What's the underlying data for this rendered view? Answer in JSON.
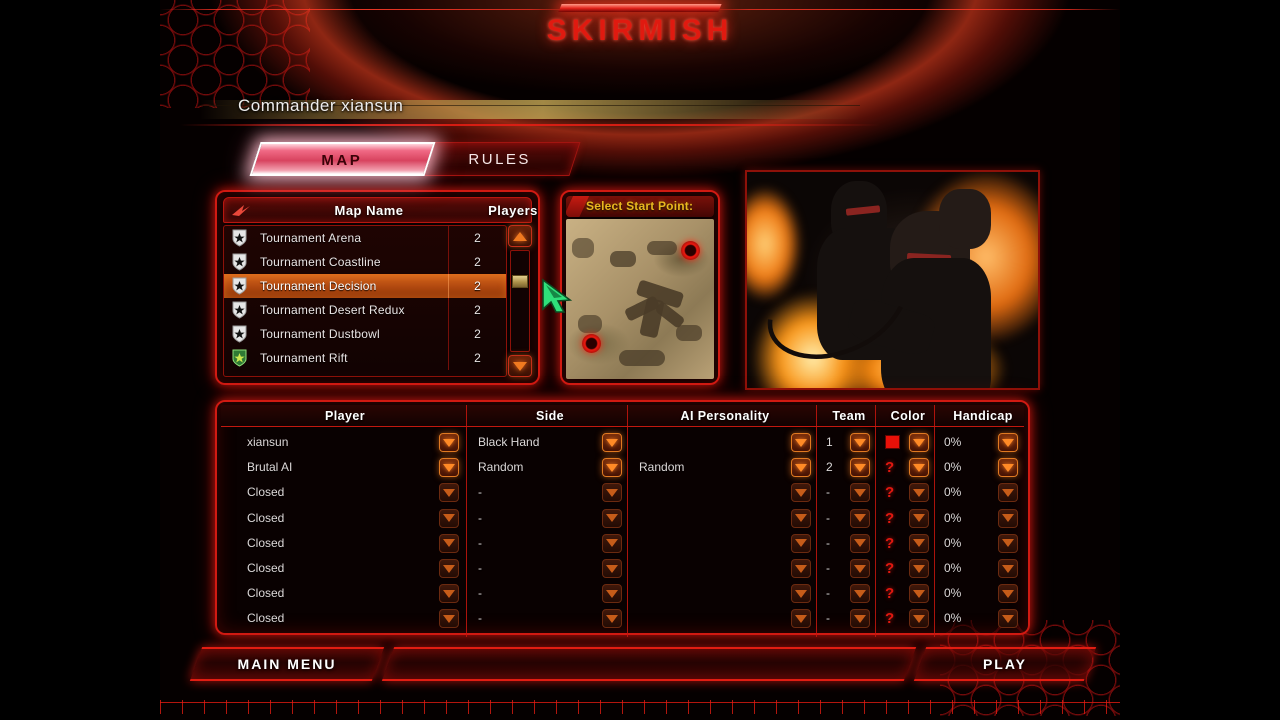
{
  "window": {
    "title": "SKIRMISH",
    "commander_label": "Commander xiansun"
  },
  "theme": {
    "accent_red": "#e21d12",
    "accent_orange": "#f07a20",
    "accent_gold": "#e9b81f",
    "selected_row": "#d96a1e",
    "player_color_swatch": "#e81008"
  },
  "tabs": [
    {
      "id": "map",
      "label": "MAP",
      "selected": true
    },
    {
      "id": "rules",
      "label": "RULES",
      "selected": false
    }
  ],
  "map_list": {
    "headers": {
      "name": "Map Name",
      "players": "Players"
    },
    "rows": [
      {
        "name": "Tournament Arena",
        "players": "2",
        "icon": "shield-star-icon",
        "official": true,
        "selected": false
      },
      {
        "name": "Tournament Coastline",
        "players": "2",
        "icon": "shield-star-icon",
        "official": true,
        "selected": false
      },
      {
        "name": "Tournament Decision",
        "players": "2",
        "icon": "shield-star-icon",
        "official": true,
        "selected": true
      },
      {
        "name": "Tournament Desert Redux",
        "players": "2",
        "icon": "shield-star-icon",
        "official": true,
        "selected": false
      },
      {
        "name": "Tournament Dustbowl",
        "players": "2",
        "icon": "shield-star-icon",
        "official": true,
        "selected": false
      },
      {
        "name": "Tournament Rift",
        "players": "2",
        "icon": "shield-star-green-icon",
        "official": false,
        "selected": false
      }
    ],
    "scrollbar": {
      "up": "scroll-up-icon",
      "down": "scroll-down-icon"
    }
  },
  "start_point": {
    "label": "Select Start Point:",
    "markers": [
      {
        "id": "start-point-1",
        "x": 78,
        "y": 18
      },
      {
        "id": "start-point-2",
        "x": 14,
        "y": 75
      }
    ]
  },
  "faction_art": {
    "alt": "Black Hand flamethrower troopers artwork"
  },
  "player_table": {
    "headers": [
      "Player",
      "Side",
      "AI Personality",
      "Team",
      "Color",
      "Handicap"
    ],
    "rows": [
      {
        "player": "xiansun",
        "side": "Black Hand",
        "ai": "",
        "team": "1",
        "color": "#e81008",
        "color_unset": false,
        "handicap": "0%",
        "active": true
      },
      {
        "player": "Brutal AI",
        "side": "Random",
        "ai": "Random",
        "team": "2",
        "color": "",
        "color_unset": true,
        "handicap": "0%",
        "active": true
      },
      {
        "player": "Closed",
        "side": "-",
        "ai": "",
        "team": "-",
        "color": "",
        "color_unset": true,
        "handicap": "0%",
        "active": false
      },
      {
        "player": "Closed",
        "side": "-",
        "ai": "",
        "team": "-",
        "color": "",
        "color_unset": true,
        "handicap": "0%",
        "active": false
      },
      {
        "player": "Closed",
        "side": "-",
        "ai": "",
        "team": "-",
        "color": "",
        "color_unset": true,
        "handicap": "0%",
        "active": false
      },
      {
        "player": "Closed",
        "side": "-",
        "ai": "",
        "team": "-",
        "color": "",
        "color_unset": true,
        "handicap": "0%",
        "active": false
      },
      {
        "player": "Closed",
        "side": "-",
        "ai": "",
        "team": "-",
        "color": "",
        "color_unset": true,
        "handicap": "0%",
        "active": false
      },
      {
        "player": "Closed",
        "side": "-",
        "ai": "",
        "team": "-",
        "color": "",
        "color_unset": true,
        "handicap": "0%",
        "active": false
      }
    ],
    "color_unset_glyph": "?"
  },
  "footer": {
    "main_menu_label": "MAIN MENU",
    "play_label": "PLAY"
  }
}
